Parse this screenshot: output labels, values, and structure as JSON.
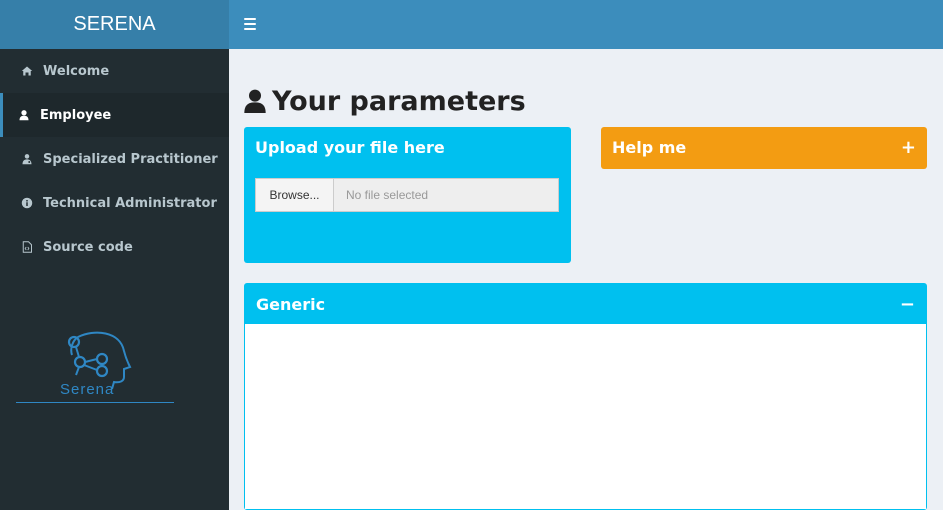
{
  "app": {
    "title": "SERENA"
  },
  "sidebar": {
    "items": [
      {
        "label": "Welcome",
        "icon": "home-icon"
      },
      {
        "label": "Employee",
        "icon": "user-icon",
        "active": true
      },
      {
        "label": "Specialized Practitioner",
        "icon": "user-md-icon"
      },
      {
        "label": "Technical Administrator",
        "icon": "info-circle-icon"
      },
      {
        "label": "Source code",
        "icon": "file-code-icon"
      }
    ],
    "brand": {
      "text": "Serena"
    }
  },
  "main": {
    "title": "Your parameters",
    "upload": {
      "title": "Upload your file here",
      "browse_label": "Browse...",
      "file_placeholder": "No file selected"
    },
    "help": {
      "title": "Help me",
      "tool": "+"
    },
    "generic": {
      "title": "Generic",
      "tool": "−"
    }
  },
  "colors": {
    "header": "#3c8dbc",
    "logo_bar": "#367fa9",
    "sidebar": "#222d32",
    "info_box": "#00c0ef",
    "warning_box": "#f39c12"
  }
}
